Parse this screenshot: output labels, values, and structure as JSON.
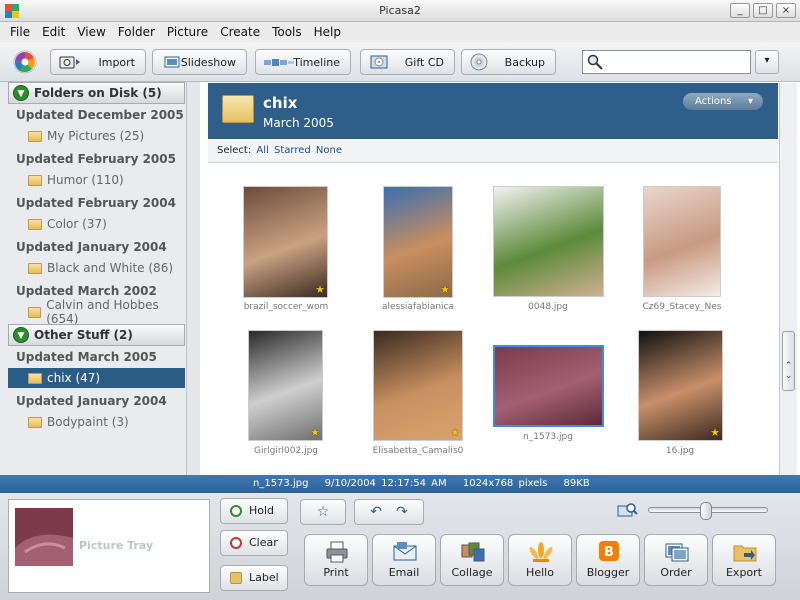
{
  "window": {
    "title": "Picasa2",
    "buttons": [
      "_",
      "□",
      "×"
    ]
  },
  "menu": [
    "File",
    "Edit",
    "View",
    "Folder",
    "Picture",
    "Create",
    "Tools",
    "Help"
  ],
  "toolbar": {
    "buttons": [
      "Import",
      "Slideshow",
      "Timeline",
      "Gift CD",
      "Backup"
    ],
    "search_value": "",
    "search_dropdown": "▾"
  },
  "sidebar": {
    "sections": [
      {
        "title": "Folders on Disk (5)",
        "groups": [
          {
            "heading": "Updated December 2005",
            "folders": [
              "My Pictures (25)"
            ]
          },
          {
            "heading": "Updated February 2005",
            "folders": [
              "Humor (110)"
            ]
          },
          {
            "heading": "Updated February 2004",
            "folders": [
              "Color (37)"
            ]
          },
          {
            "heading": "Updated January 2004",
            "folders": [
              "Black and White (86)"
            ]
          },
          {
            "heading": "Updated March 2002",
            "folders": [
              "Calvin and Hobbes (654)"
            ]
          }
        ]
      },
      {
        "title": "Other Stuff (2)",
        "groups": [
          {
            "heading": "Updated March 2005",
            "folders": [
              "chix (47)"
            ]
          },
          {
            "heading": "Updated January 2004",
            "folders": [
              "Bodypaint (3)"
            ]
          }
        ]
      }
    ],
    "selected_folder": "chix (47)"
  },
  "album": {
    "title": "chix",
    "date": "March 2005",
    "actions_label": "Actions",
    "actions_icon": "▾"
  },
  "select_bar": {
    "label": "Select:",
    "all": "All",
    "starred": "Starred",
    "none": "None"
  },
  "photos": [
    {
      "name": "brazil_soccer_wom",
      "starred": true,
      "colors": [
        "#6e4a3a",
        "#c9a282",
        "#3c2a22"
      ]
    },
    {
      "name": "alessiafabianica",
      "starred": true,
      "colors": [
        "#3a6eb5",
        "#c98f5e",
        "#8a6a4a"
      ]
    },
    {
      "name": "0048.jpg",
      "starred": false,
      "colors": [
        "#f2f2f0",
        "#5c8a3a",
        "#d0b090"
      ]
    },
    {
      "name": "Cz69_Stacey_Nes",
      "starred": false,
      "colors": [
        "#e9d6cd",
        "#c89a82",
        "#f4ebe6"
      ]
    },
    {
      "name": "Girlgirl002.jpg",
      "starred": true,
      "colors": [
        "#2a2a2a",
        "#cfcfcf",
        "#6f6f6f"
      ]
    },
    {
      "name": "Elisabetta_Camalis0",
      "starred": true,
      "colors": [
        "#3a2a20",
        "#c89060",
        "#d9a36d"
      ]
    },
    {
      "name": "n_1573.jpg",
      "starred": false,
      "colors": [
        "#7c3a4a",
        "#a26072",
        "#5e2a38"
      ]
    },
    {
      "name": "16.jpg",
      "starred": true,
      "colors": [
        "#111111",
        "#c98f6a",
        "#3a2a20"
      ]
    }
  ],
  "status": {
    "filename": "n_1573.jpg",
    "datetime": "9/10/2004 12:17:54 AM",
    "dimensions": "1024x768 pixels",
    "size": "89KB"
  },
  "tray": {
    "label": "Picture Tray",
    "buttons": [
      "Hold",
      "Clear",
      "Label"
    ]
  },
  "actions": [
    "Print",
    "Email",
    "Collage",
    "Hello",
    "Blogger",
    "Order",
    "Export"
  ],
  "zoom": {
    "level": 0.5
  },
  "colors": {
    "accent": "#2d5f8a",
    "status": "#3670a8",
    "selection": "#2a5c86"
  }
}
